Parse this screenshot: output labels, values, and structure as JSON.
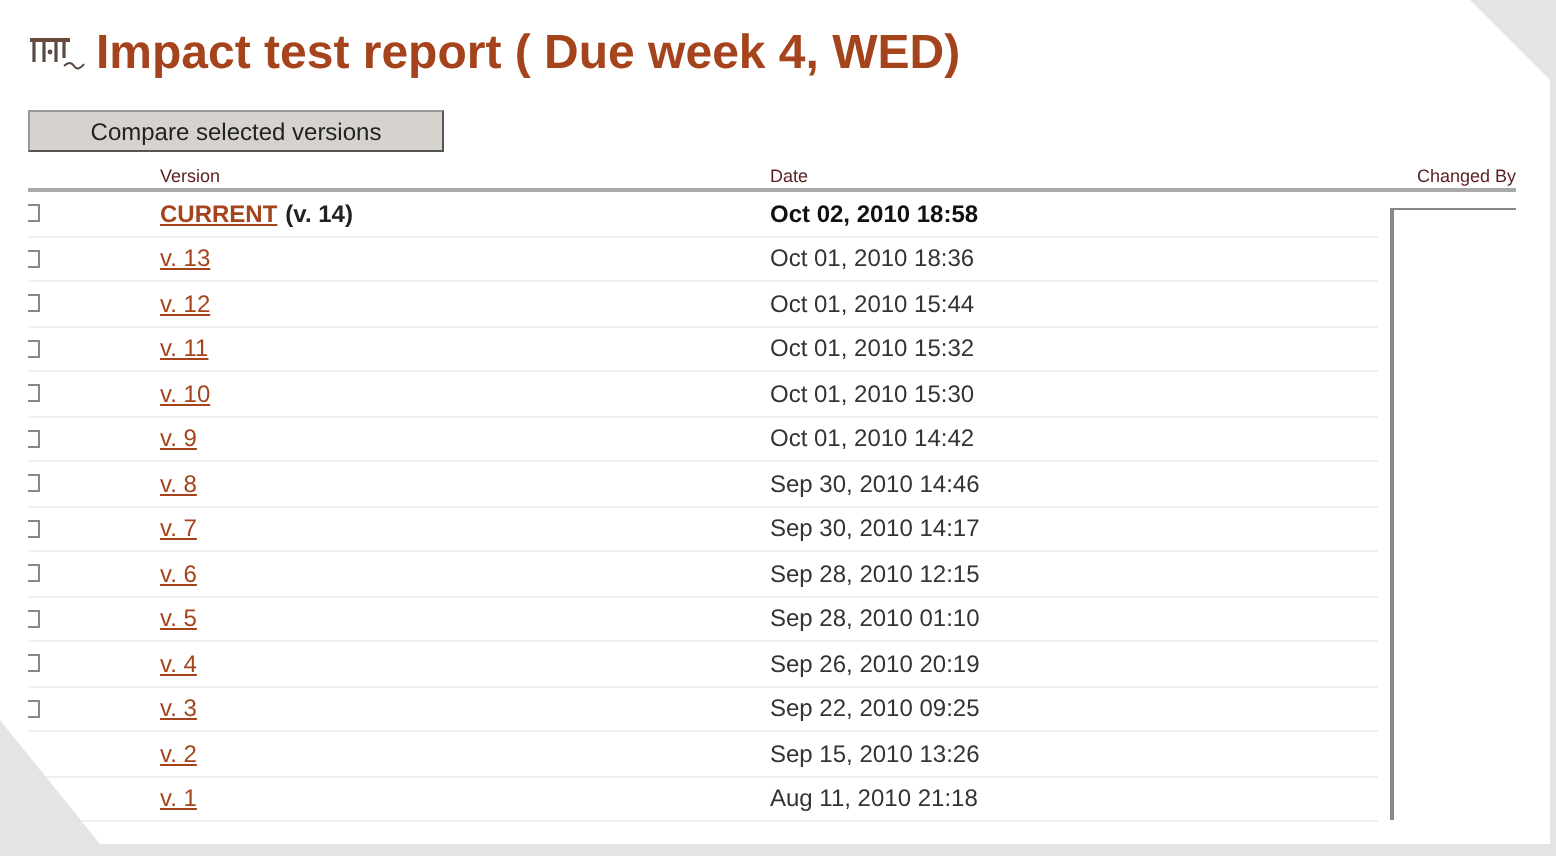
{
  "page": {
    "title": "Impact test report ( Due week 4, WED)"
  },
  "compare_button": "Compare selected versions",
  "table": {
    "columns": [
      "Version",
      "Date",
      "Changed By"
    ],
    "rows": [
      {
        "version": "CURRENT",
        "note": "(v. 14)",
        "date": "Oct 02, 2010 18:58",
        "current": true,
        "checked": false
      },
      {
        "version": "v. 13",
        "date": "Oct 01, 2010 18:36",
        "current": false,
        "checked": false
      },
      {
        "version": "v. 12",
        "date": "Oct 01, 2010 15:44",
        "current": false,
        "checked": false
      },
      {
        "version": "v. 11",
        "date": "Oct 01, 2010 15:32",
        "current": false,
        "checked": false
      },
      {
        "version": "v. 10",
        "date": "Oct 01, 2010 15:30",
        "current": false,
        "checked": false
      },
      {
        "version": "v. 9",
        "date": "Oct 01, 2010 14:42",
        "current": false,
        "checked": false
      },
      {
        "version": "v. 8",
        "date": "Sep 30, 2010 14:46",
        "current": false,
        "checked": false
      },
      {
        "version": "v. 7",
        "date": "Sep 30, 2010 14:17",
        "current": false,
        "checked": false
      },
      {
        "version": "v. 6",
        "date": "Sep 28, 2010 12:15",
        "current": false,
        "checked": false
      },
      {
        "version": "v. 5",
        "date": "Sep 28, 2010 01:10",
        "current": false,
        "checked": false
      },
      {
        "version": "v. 4",
        "date": "Sep 26, 2010 20:19",
        "current": false,
        "checked": false
      },
      {
        "version": "v. 3",
        "date": "Sep 22, 2010 09:25",
        "current": false,
        "checked": false
      },
      {
        "version": "v. 2",
        "date": "Sep 15, 2010 13:26",
        "current": false
      },
      {
        "version": "v. 1",
        "date": "Aug 11, 2010 21:18",
        "current": false
      }
    ]
  }
}
